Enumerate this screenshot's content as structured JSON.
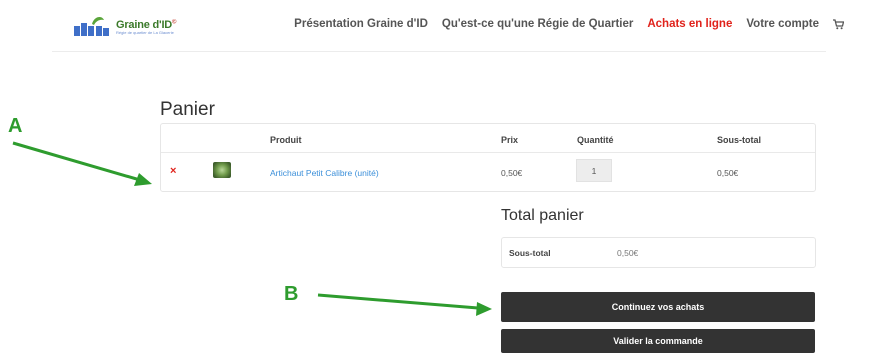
{
  "header": {
    "logo_text": "Graine d'ID",
    "logo_mark": "©",
    "logo_tagline": "Régie de quartier de La Glacerie",
    "nav": [
      {
        "label": "Présentation Graine d'ID",
        "active": false
      },
      {
        "label": "Qu'est-ce qu'une Régie de Quartier",
        "active": false
      },
      {
        "label": "Achats en ligne",
        "active": true
      },
      {
        "label": "Votre compte",
        "active": false
      }
    ],
    "cart_icon": "cart-icon"
  },
  "page": {
    "title": "Panier"
  },
  "cart": {
    "columns": {
      "product": "Produit",
      "price": "Prix",
      "quantity": "Quantité",
      "subtotal": "Sous-total"
    },
    "items": [
      {
        "remove": "×",
        "name": "Artichaut Petit Calibre (unité)",
        "price": "0,50€",
        "quantity": "1",
        "subtotal": "0,50€"
      }
    ]
  },
  "totals": {
    "title": "Total panier",
    "subtotal_label": "Sous-total",
    "subtotal_value": "0,50€"
  },
  "buttons": {
    "continue": "Continuez vos achats",
    "validate": "Valider la commande"
  },
  "annotations": {
    "a": "A",
    "b": "B",
    "color": "#2e9c2e"
  },
  "colors": {
    "accent_red": "#e0221b",
    "link_blue": "#3b8fd9",
    "button_dark": "#333333"
  }
}
